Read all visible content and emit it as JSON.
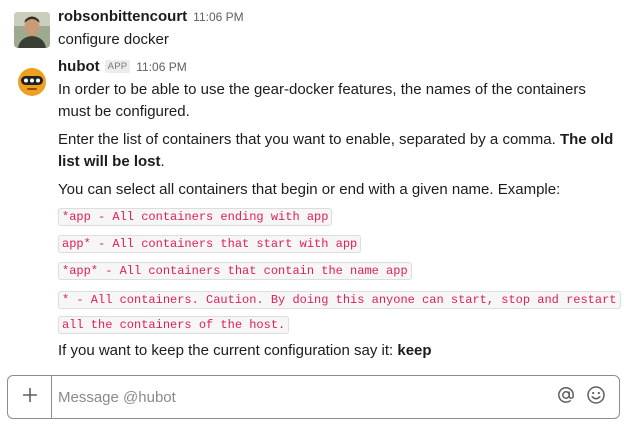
{
  "messages": [
    {
      "sender": "robsonbittencourt",
      "time": "11:06 PM",
      "text": "configure docker"
    },
    {
      "sender": "hubot",
      "badge": "APP",
      "time": "11:06 PM",
      "para1": "In order to be able to use the gear-docker features, the names of the containers must be configured.",
      "para2_prefix": "Enter the list of containers that you want to enable, separated by a comma. ",
      "para2_bold": "The old list will be lost",
      "para2_suffix": ".",
      "para3": "You can select all containers that begin or end with a given name. Example:",
      "code_lines": [
        "*app - All containers ending with app",
        "app* - All containers that start with app",
        "*app* - All containers that contain the name app",
        "* - All containers. Caution. By doing this anyone can start, stop and restart all the containers of the host."
      ],
      "para4_prefix": "If you want to keep the current configuration say it: ",
      "para4_bold": "keep"
    }
  ],
  "composer": {
    "plus_icon": "plus-icon",
    "placeholder": "Message @hubot",
    "mention_icon": "at-sign-icon",
    "emoji_icon": "smiley-icon"
  },
  "colors": {
    "code_text": "#e01e5a",
    "code_bg": "#f6f6f6",
    "hubot_avatar": "#f0a020"
  }
}
